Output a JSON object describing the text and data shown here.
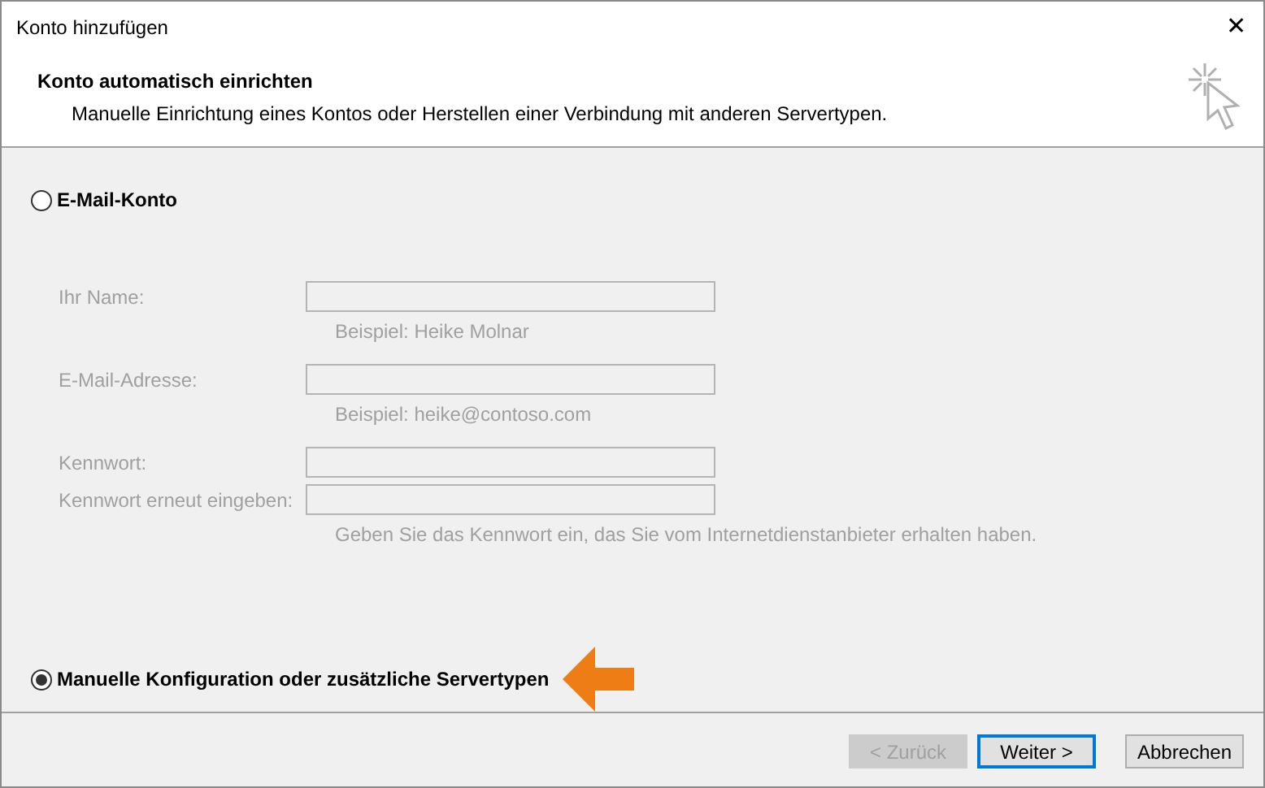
{
  "window": {
    "title": "Konto hinzufügen",
    "close": "✕"
  },
  "header": {
    "title": "Konto automatisch einrichten",
    "subtitle": "Manuelle Einrichtung eines Kontos oder Herstellen einer Verbindung mit anderen Servertypen."
  },
  "options": [
    {
      "label": "E-Mail-Konto",
      "selected": false
    },
    {
      "label": "Manuelle Konfiguration oder zusätzliche Servertypen",
      "selected": true
    }
  ],
  "form": {
    "disabled": true,
    "fields": [
      {
        "label": "Ihr Name:",
        "hint": "Beispiel: Heike Molnar"
      },
      {
        "label": "E-Mail-Adresse:",
        "hint": "Beispiel: heike@contoso.com"
      },
      {
        "label": "Kennwort:"
      },
      {
        "label": "Kennwort erneut eingeben:",
        "hint": "Geben Sie das Kennwort ein, das Sie vom Internetdienstanbieter erhalten haben."
      }
    ]
  },
  "buttons": [
    {
      "label": "< Zurück",
      "disabled": true,
      "default": false
    },
    {
      "label": "Weiter >",
      "disabled": false,
      "default": true
    },
    {
      "label": "Abbrechen",
      "disabled": false,
      "default": false
    }
  ]
}
